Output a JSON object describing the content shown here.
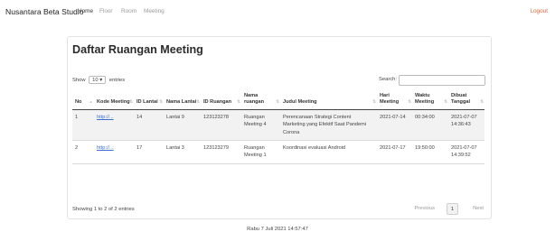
{
  "navbar": {
    "brand": "Nusantara Beta Studio",
    "links": [
      "Home",
      "Floor",
      "Room",
      "Meeting"
    ],
    "logout": "Logout"
  },
  "card": {
    "title": "Daftar Ruangan Meeting",
    "length": {
      "show": "Show",
      "value": "10",
      "entries": "entries"
    },
    "search_label": "Search:",
    "columns": [
      "No",
      "Kode Meeting",
      "ID Lantai",
      "Nama Lantai",
      "ID Ruangan",
      "Nama ruangan",
      "Judul Meeting",
      "Hari Meeting",
      "Waktu Meeting",
      "Dibuat Tanggal"
    ],
    "rows": [
      [
        "1",
        "http://...",
        "14",
        "Lantai 9",
        "123123278",
        "Ruangan Meeting 4",
        "Perencanaan Strategi Content Marketing yang Efektif Saat Pandemi Corona",
        "2021-07-14",
        "00:34:00",
        "2021-07-07 14:36:43"
      ],
      [
        "2",
        "http://...",
        "17",
        "Lantai 3",
        "123123279",
        "Ruangan Meeting 1",
        "Koordinasi evaluasi Android",
        "2021-07-17",
        "19:50:00",
        "2021-07-07 14:39:52"
      ]
    ],
    "info": "Showing 1 to 2 of 2 entries",
    "pagination": {
      "previous": "Previous",
      "current": "1",
      "next": "Next"
    }
  },
  "footer": "Rabu 7 Juli 2021 14:57:47",
  "colors": {
    "link": "#3a6fcf",
    "logout": "#e0673c",
    "stripe": "#f2f2f2"
  }
}
